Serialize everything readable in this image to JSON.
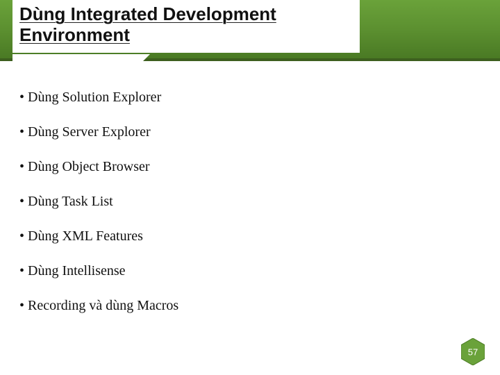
{
  "header": {
    "title_line1": "Dùng Integrated Development",
    "title_line2": "Environment"
  },
  "bullets": [
    "Dùng Solution Explorer",
    "Dùng Server Explorer",
    "Dùng Object Browser",
    "Dùng Task List",
    "Dùng XML Features",
    "Dùng Intellisense",
    "Recording và dùng Macros"
  ],
  "page_number": "57",
  "colors": {
    "accent_green": "#5c9030",
    "hex_fill": "#6aa23a"
  }
}
